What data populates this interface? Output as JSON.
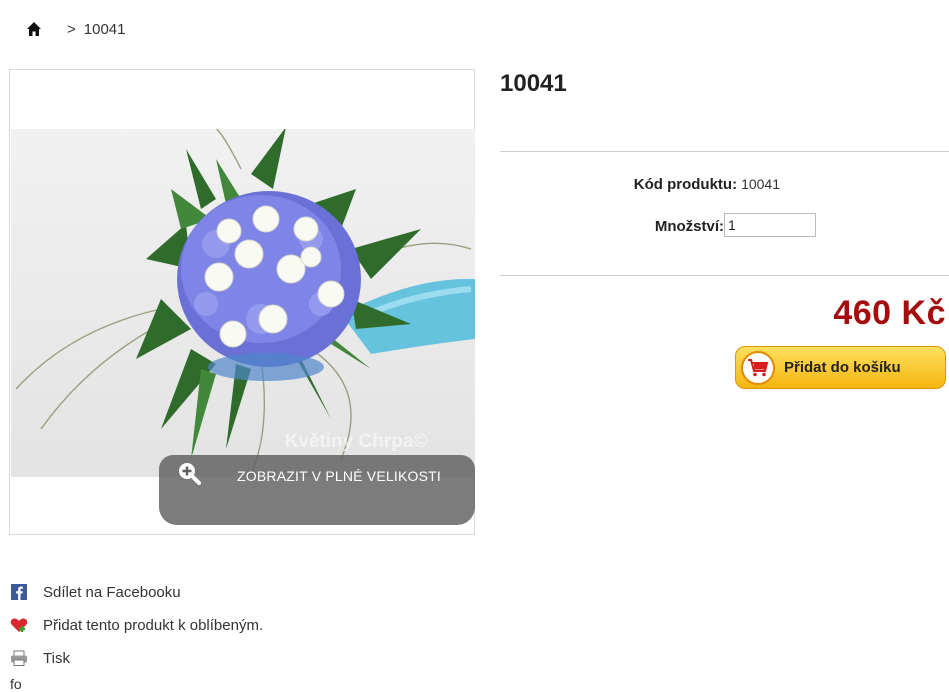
{
  "breadcrumb": {
    "home_icon": "home-icon",
    "separator": ">",
    "current": "10041"
  },
  "product": {
    "title": "10041",
    "code_label": "Kód produktu:",
    "code_value": "10041",
    "quantity_label": "Množství:",
    "quantity_value": "1",
    "price": "460 Kč",
    "add_to_cart_label": "Přidat do košíku",
    "image_watermark": "Květiny Chrpa©",
    "zoom_label": "ZOBRAZIT V PLNÉ VELIKOSTI"
  },
  "links": [
    {
      "icon": "facebook-icon",
      "label": "Sdílet na Facebooku"
    },
    {
      "icon": "heart-icon",
      "label": "Přidat tento produkt k oblíbeným."
    },
    {
      "icon": "printer-icon",
      "label": "Tisk"
    }
  ],
  "footer_text": "fo",
  "colors": {
    "price": "#a50d0d",
    "cart_button": "#f6b511",
    "facebook": "#3b5998"
  }
}
